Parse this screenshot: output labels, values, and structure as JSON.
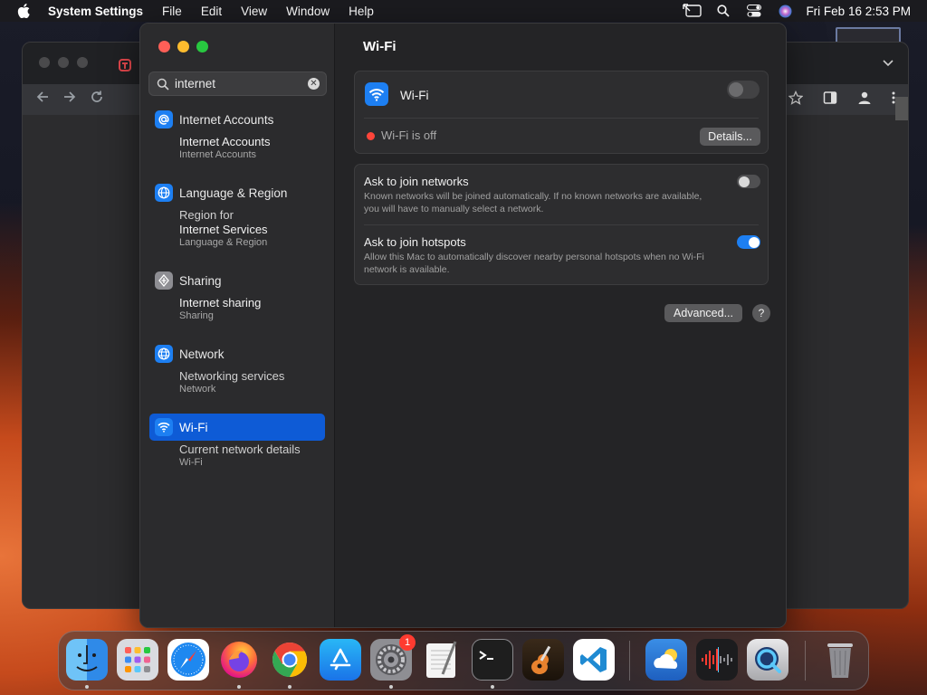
{
  "menubar": {
    "app_name": "System Settings",
    "items": [
      "File",
      "Edit",
      "View",
      "Window",
      "Help"
    ],
    "clock": "Fri Feb 16  2:53 PM"
  },
  "search": {
    "value": "internet"
  },
  "results": [
    {
      "category": "Internet Accounts",
      "icon": "at-icon",
      "color": "#1d7ff2",
      "sub_title_pre": "",
      "sub_title_bold": "Internet Accounts",
      "sub_title_post": "",
      "sub_desc": "Internet Accounts"
    },
    {
      "category": "Language & Region",
      "icon": "globe-icon",
      "color": "#1d7ff2",
      "sub_title_pre": "Region for",
      "sub_title_bold": "Internet Services",
      "sub_title_post": "",
      "sub_desc": "Language & Region"
    },
    {
      "category": "Sharing",
      "icon": "sharing-icon",
      "color": "#8e8e93",
      "sub_title_pre": "",
      "sub_title_bold": "Internet sharing",
      "sub_title_post": "",
      "sub_desc": "Sharing"
    },
    {
      "category": "Network",
      "icon": "network-globe-icon",
      "color": "#1d7ff2",
      "sub_title_pre": "",
      "sub_title_bold": "",
      "sub_title_post": "Networking services",
      "sub_desc": "Network"
    },
    {
      "category": "Wi-Fi",
      "icon": "wifi-icon",
      "color": "#1d7ff2",
      "sub_title_pre": "",
      "sub_title_bold": "",
      "sub_title_post": "Current network details",
      "sub_desc": "Wi-Fi"
    }
  ],
  "main": {
    "title": "Wi-Fi",
    "wifi_label": "Wi-Fi",
    "wifi_status": "Wi-Fi is off",
    "details_button": "Details...",
    "ask_networks_title": "Ask to join networks",
    "ask_networks_desc": "Known networks will be joined automatically. If no known networks are available, you will have to manually select a network.",
    "ask_hotspots_title": "Ask to join hotspots",
    "ask_hotspots_desc": "Allow this Mac to automatically discover nearby personal hotspots when no Wi-Fi network is available.",
    "advanced_button": "Advanced...",
    "help_button": "?"
  },
  "toggles": {
    "wifi": false,
    "ask_networks": false,
    "ask_hotspots": true
  },
  "dock": {
    "items": [
      "Finder",
      "Launchpad",
      "Safari",
      "Firefox",
      "Chrome",
      "App Store",
      "System Settings",
      "TextEdit",
      "Terminal",
      "GarageBand",
      "Visual Studio Code",
      "Weather",
      "Voice Memos",
      "QuickTime Player",
      "Trash"
    ],
    "settings_badge": "1"
  },
  "colors": {
    "accent": "#0e5bd6",
    "toggle_on": "#1d7ff2",
    "status_off": "#ff453a"
  }
}
